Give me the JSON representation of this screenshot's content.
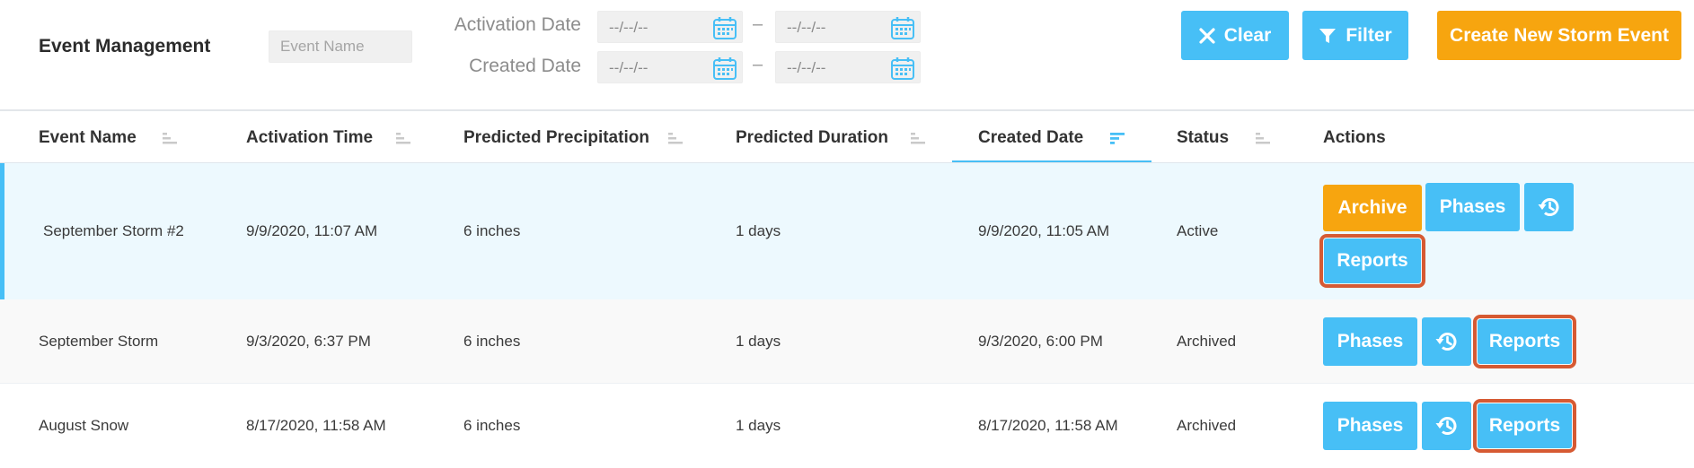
{
  "header": {
    "title": "Event Management",
    "event_name_placeholder": "Event Name",
    "activation_label": "Activation Date",
    "created_label": "Created Date",
    "date_placeholder": "--/--/--",
    "range_separator": "–",
    "clear_label": "Clear",
    "filter_label": "Filter",
    "create_label": "Create New Storm Event"
  },
  "columns": {
    "event_name": "Event Name",
    "activation_time": "Activation Time",
    "predicted_precipitation": "Predicted Precipitation",
    "predicted_duration": "Predicted Duration",
    "created_date": "Created Date",
    "status": "Status",
    "actions": "Actions"
  },
  "rows": [
    {
      "name": "September Storm #2",
      "activation_time": "9/9/2020, 11:07 AM",
      "precipitation": "6 inches",
      "duration": "1 days",
      "created_date": "9/9/2020, 11:05 AM",
      "status": "Active",
      "archive_label": "Archive",
      "phases_label": "Phases",
      "reports_label": "Reports"
    },
    {
      "name": "September Storm",
      "activation_time": "9/3/2020, 6:37 PM",
      "precipitation": "6 inches",
      "duration": "1 days",
      "created_date": "9/3/2020, 6:00 PM",
      "status": "Archived",
      "phases_label": "Phases",
      "reports_label": "Reports"
    },
    {
      "name": "August Snow",
      "activation_time": "8/17/2020, 11:58 AM",
      "precipitation": "6 inches",
      "duration": "1 days",
      "created_date": "8/17/2020, 11:58 AM",
      "status": "Archived",
      "phases_label": "Phases",
      "reports_label": "Reports"
    }
  ],
  "colors": {
    "accent_blue": "#47bff6",
    "accent_orange": "#f7a50f",
    "highlight_outline": "#d65a33",
    "selected_row_bg": "#edf9fe",
    "alt_row_bg": "#f9f9f9"
  },
  "icons": {
    "calendar": "calendar-icon",
    "clear": "close-icon",
    "filter": "funnel-icon",
    "sort": "sort-icon",
    "history": "history-icon"
  },
  "sorted_column": "created_date"
}
